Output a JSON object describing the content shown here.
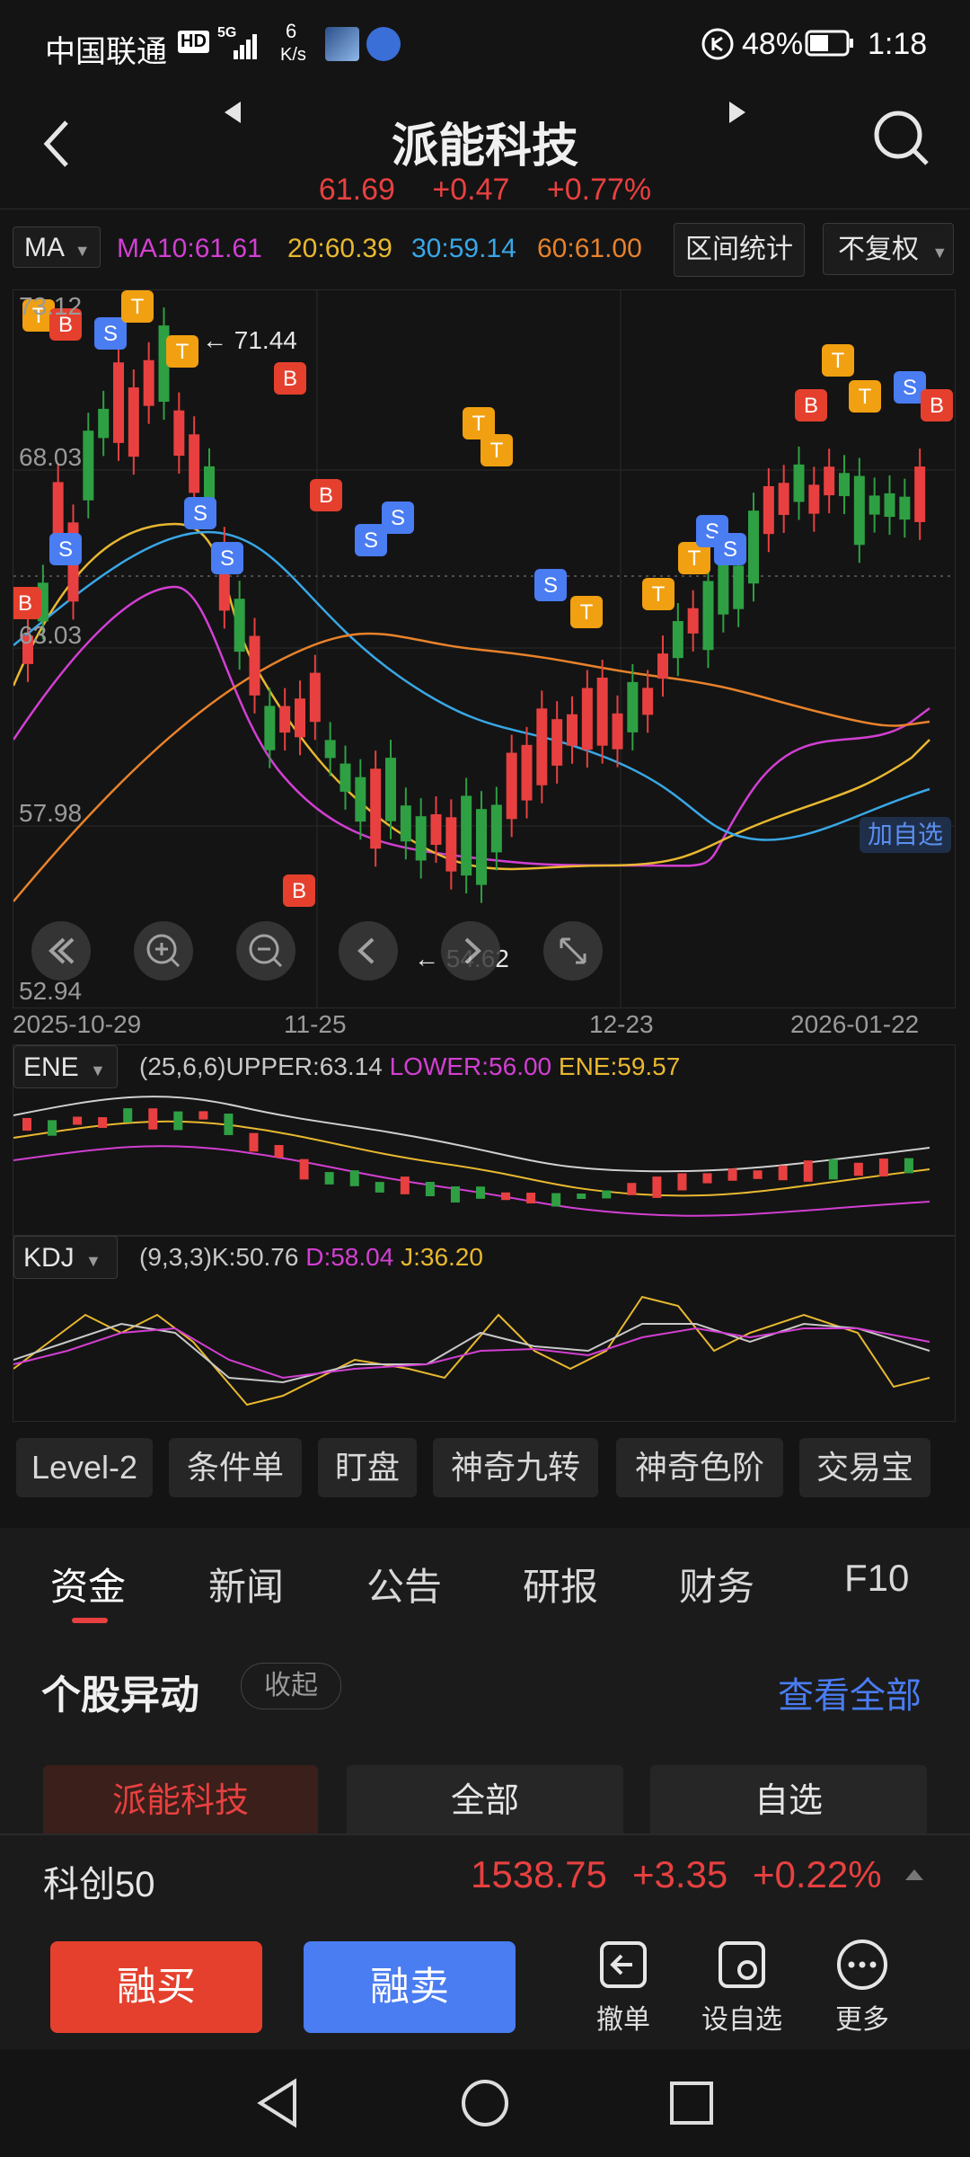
{
  "status_bar": {
    "carrier": "中国联通",
    "hd": "HD",
    "net_type": "5G",
    "speed_value": "6",
    "speed_unit": "K/s",
    "battery": "48%",
    "time": "1:18"
  },
  "header": {
    "title": "派能科技",
    "price": "61.69",
    "change": "+0.47",
    "change_pct": "+0.77%"
  },
  "ma_row": {
    "indicator": "MA",
    "ma10": "MA10:61.61",
    "ma20": "20:60.39",
    "ma30": "30:59.14",
    "ma60": "60:61.00",
    "range_stats": "区间统计",
    "adjust": "不复权"
  },
  "main_chart": {
    "y_ticks": [
      "73.12",
      "68.03",
      "63.03",
      "57.98",
      "52.94"
    ],
    "x_ticks": [
      "2025-10-29",
      "11-25",
      "12-23",
      "2026-01-22"
    ],
    "high_note": "← 71.44",
    "low_note": "← 54.62",
    "add_watch": "加自选",
    "markers": [
      "B",
      "S",
      "T"
    ]
  },
  "ene": {
    "label": "ENE",
    "params": "(25,6,6)UPPER:63.14",
    "lower": "LOWER:56.00",
    "ene": "ENE:59.57"
  },
  "kdj": {
    "label": "KDJ",
    "params": "(9,3,3)K:50.76",
    "d": "D:58.04",
    "j": "J:36.20"
  },
  "tool_tabs": [
    "Level-2",
    "条件单",
    "盯盘",
    "神奇九转",
    "神奇色阶",
    "交易宝"
  ],
  "info_tabs": [
    "资金",
    "新闻",
    "公告",
    "研报",
    "财务",
    "F10"
  ],
  "section": {
    "title": "个股异动",
    "collapse": "收起",
    "view_all": "查看全部",
    "filters": [
      "派能科技",
      "全部",
      "自选"
    ]
  },
  "index_bar": {
    "name": "科创50",
    "value": "1538.75",
    "change": "+3.35",
    "pct": "+0.22%"
  },
  "actions": {
    "buy": "融买",
    "sell": "融卖",
    "cancel": "撤单",
    "set_watch": "设自选",
    "more": "更多"
  },
  "colors": {
    "up": "#e84040",
    "down": "#2ea043",
    "ma10": "#d23fd2",
    "ma20": "#e8b830",
    "ma30": "#39a7e6",
    "ma60": "#e8822b",
    "buy": "#e5402e",
    "sell": "#4a7cf2"
  }
}
